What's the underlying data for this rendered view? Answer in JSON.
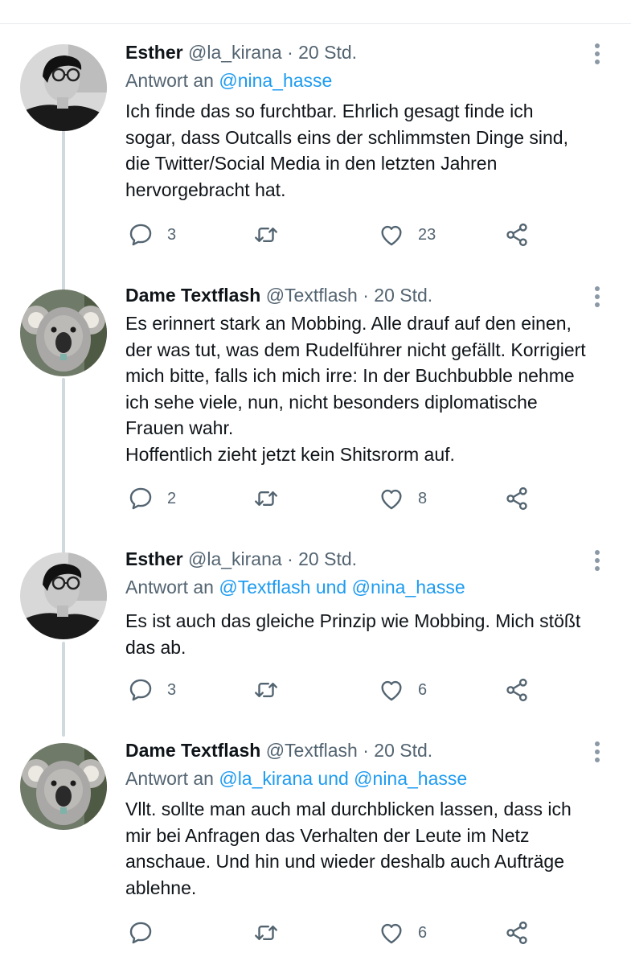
{
  "tweets": [
    {
      "name": "Esther",
      "handle": "@la_kirana",
      "sep": "·",
      "time": "20 Std.",
      "reply_prefix": "Antwort an",
      "reply_to": "@nina_hasse",
      "text": "Ich finde das so furchtbar. Ehrlich gesagt finde ich\nsogar, dass Outcalls eins der schlimmsten Dinge sind,\ndie Twitter/Social Media in den letzten Jahren\nhervorgebracht hat.",
      "replies": "3",
      "retweets": "",
      "likes": "23",
      "avatar": "person-with-glasses"
    },
    {
      "name": "Dame Textflash",
      "handle": "@Textflash",
      "sep": "·",
      "time": "20 Std.",
      "reply_prefix": "",
      "reply_to": "",
      "text": "Es erinnert stark an Mobbing. Alle drauf auf den einen,\nder was tut, was dem Rudelführer nicht gefällt. Korrigiert\nmich bitte, falls ich mich irre: In der Buchbubble nehme\nich sehe viele, nun, nicht besonders diplomatische\nFrauen wahr.\nHoffentlich zieht jetzt kein Shitsrorm auf.",
      "replies": "2",
      "retweets": "",
      "likes": "8",
      "avatar": "koala"
    },
    {
      "name": "Esther",
      "handle": "@la_kirana",
      "sep": "·",
      "time": "20 Std.",
      "reply_prefix": "Antwort an",
      "reply_to": "@Textflash und @nina_hasse",
      "text": "Es ist auch das gleiche Prinzip wie Mobbing. Mich stößt\ndas ab.",
      "replies": "3",
      "retweets": "",
      "likes": "6",
      "avatar": "person-with-glasses"
    },
    {
      "name": "Dame Textflash",
      "handle": "@Textflash",
      "sep": "·",
      "time": "20 Std.",
      "reply_prefix": "Antwort an",
      "reply_to": "@la_kirana und @nina_hasse",
      "text": "Vllt. sollte man auch mal durchblicken lassen, dass ich\nmir bei Anfragen das Verhalten der Leute im Netz\nanschaue. Und hin und wieder deshalb auch Aufträge\nablehne.",
      "replies": "",
      "retweets": "",
      "likes": "6",
      "avatar": "koala"
    }
  ],
  "colors": {
    "text": "#0f1419",
    "secondary": "#536471",
    "link": "#1d9bf0",
    "thread_line": "#cfd9de"
  },
  "icons": [
    "reply-icon",
    "retweet-icon",
    "like-icon",
    "share-icon",
    "more-icon"
  ]
}
